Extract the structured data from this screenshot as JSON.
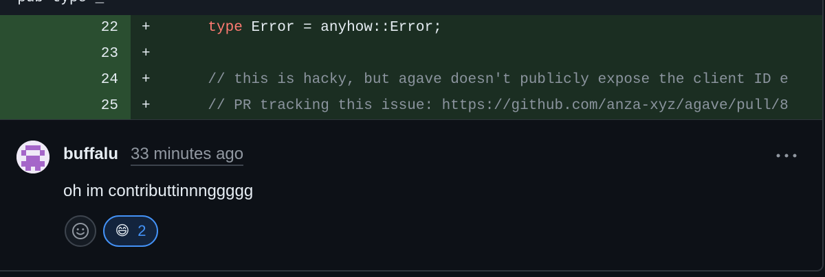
{
  "diff": {
    "top_partial": "  pub type _",
    "rows": [
      {
        "line": "22",
        "marker": "+",
        "indent": "    ",
        "keyword": "type",
        "rest": " Error = anyhow::Error;",
        "comment": ""
      },
      {
        "line": "23",
        "marker": "+",
        "indent": "",
        "keyword": "",
        "rest": "",
        "comment": ""
      },
      {
        "line": "24",
        "marker": "+",
        "indent": "    ",
        "keyword": "",
        "rest": "",
        "comment": "// this is hacky, but agave doesn't publicly expose the client ID e"
      },
      {
        "line": "25",
        "marker": "+",
        "indent": "    ",
        "keyword": "",
        "rest": "",
        "comment": "// PR tracking this issue: https://github.com/anza-xyz/agave/pull/8"
      }
    ]
  },
  "comment": {
    "author": "buffalu",
    "timestamp": "33 minutes ago",
    "body": "oh im contributtinnnggggg",
    "reactions": [
      {
        "emoji": "😄",
        "count": "2"
      }
    ]
  },
  "colors": {
    "background": "#0d1117",
    "diff_line_number_bg": "#2a4e30",
    "diff_code_bg": "#1b2e22",
    "keyword": "#ff7b72",
    "comment_text": "#8b949e",
    "accent": "#4493f8"
  },
  "icons": [
    "smiley-icon",
    "kebab-menu-icon",
    "avatar-identicon"
  ]
}
